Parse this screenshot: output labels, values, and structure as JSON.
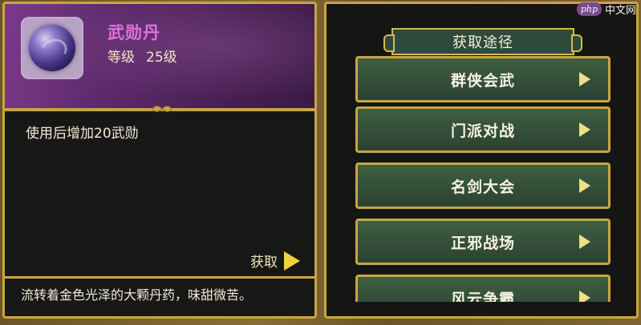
{
  "item": {
    "name": "武勋丹",
    "level_label": "等级",
    "level_value": "25级",
    "description": "使用后增加20武勋",
    "obtain_label": "获取",
    "flavor_text": "流转着金色光泽的大颗丹药，味甜微苦。"
  },
  "sources": {
    "title": "获取途径",
    "items": [
      {
        "label": "群侠会武"
      },
      {
        "label": "门派对战"
      },
      {
        "label": "名剑大会"
      },
      {
        "label": "正邪战场"
      },
      {
        "label": "风云争霸"
      }
    ]
  },
  "watermark": {
    "logo": "php",
    "text": "中文网"
  },
  "colors": {
    "frame_gold": "#c9a544",
    "item_name": "#e070e0",
    "row_green": "#3f5e3e",
    "arrow_yellow": "#f0d23a"
  }
}
